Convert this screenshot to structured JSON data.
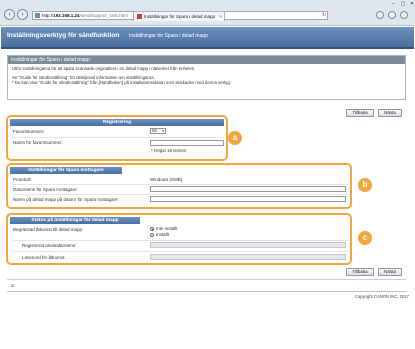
{
  "browser": {
    "url": "http://192.168.1.24/send/support_smb.html",
    "url_prefix": "http://",
    "url_host": "192.168.1.24",
    "url_path": "/send/support_smb.html",
    "tab_title": "Inställningar för Spara i delad mapp",
    "refresh_glyph": "↻",
    "search_glyph": "⌕"
  },
  "app": {
    "title": "Inställningsverktyg för sändfunktion",
    "page": "Inställningar för Spara i delad mapp"
  },
  "intro": {
    "title": "Inställningar för Spara i delad mapp",
    "line1": "Utför inställningarna för att spara scannade originaltext i en delad mapp i nätverket från enheten.",
    "line2": "Se \"Guide för sändinställning\" för detaljerad information om inställningarna.",
    "line3": "* Du kan visa \"Guide för sändinställning\" från [Handboken] på installationsskivan som skickades med denna vertyg."
  },
  "buttons": {
    "back": "Tillbaka",
    "next": "Nästa"
  },
  "registration": {
    "heading": "Registrering",
    "favorite_number_label": "Favoritnummer:",
    "favorite_number_value": "02",
    "favorite_name_label": "Namn för favoritnummer:",
    "favorite_name_value": "",
    "favorite_name_hint": "* Högst 16 tecken",
    "badge": "a"
  },
  "receiver": {
    "heading": "Inställningar för Spara mottagare",
    "protocol_label": "Protokoll:",
    "protocol_value": "Windows (SMB)",
    "computer_name_label": "Datornamn för Spara mottagare:",
    "folder_path_label": "Namn på delad mapp på datorn för Spara mottagare:",
    "badge": "b"
  },
  "shared_folder_status": {
    "heading": "Status på inställningar för delad mapp",
    "restricted_access_label": "Begränsad åtkomst till delad mapp:",
    "option_off": "Inte inställt",
    "option_on": "Inställt",
    "username_label": "Registrerat användarnamn:",
    "password_label": "Lösenord för åtkomst:",
    "badge": "c"
  },
  "footer": {
    "top_link": "⌅",
    "copyright": "Copyright CANON INC. 2017"
  }
}
